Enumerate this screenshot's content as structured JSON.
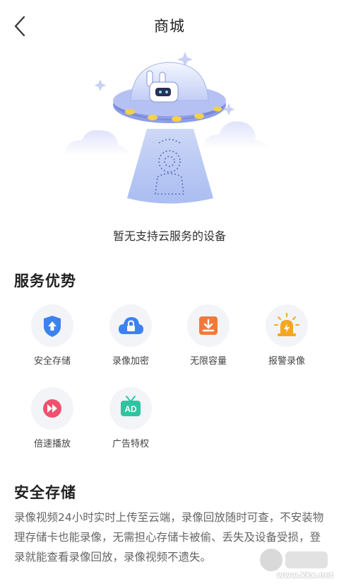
{
  "header": {
    "title": "商城"
  },
  "empty_state": {
    "message": "暂无支持云服务的设备"
  },
  "advantages": {
    "title": "服务优势",
    "items": [
      {
        "label": "安全存储",
        "icon": "shield-upload-icon",
        "color": "#3c82f0"
      },
      {
        "label": "录像加密",
        "icon": "cloud-lock-icon",
        "color": "#3c82f0"
      },
      {
        "label": "无限容量",
        "icon": "download-box-icon",
        "color": "#f07a3c"
      },
      {
        "label": "报警录像",
        "icon": "alarm-light-icon",
        "color": "#f5a623"
      },
      {
        "label": "倍速播放",
        "icon": "fast-forward-icon",
        "color": "#f0506e"
      },
      {
        "label": "广告特权",
        "icon": "ad-icon",
        "color": "#2ec4a0"
      }
    ]
  },
  "detail": {
    "title": "安全存储",
    "text": "录像视频24小时实时上传至云端，录像回放随时可查，不安装物理存储卡也能录像，无需担心存储卡被偷、丢失及设备受损，登录就能查看录像回放，录像视频不遗失。"
  },
  "watermark": {
    "url": "www.kkx.net"
  }
}
